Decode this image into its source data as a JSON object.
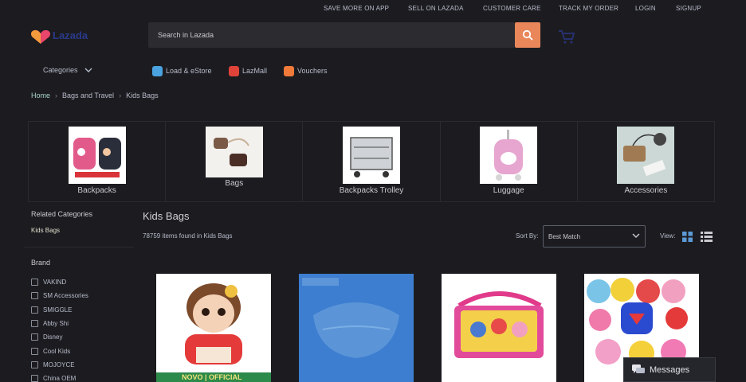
{
  "topbar": {
    "links": [
      "SAVE MORE ON APP",
      "SELL ON LAZADA",
      "CUSTOMER CARE",
      "TRACK MY ORDER",
      "LOGIN",
      "SIGNUP"
    ]
  },
  "header": {
    "logo_text": "Lazada",
    "search_placeholder": "Search in Lazada"
  },
  "nav": {
    "categories_label": "Categories",
    "quick_links": [
      {
        "label": "Load & eStore",
        "color": "#4aa3e0"
      },
      {
        "label": "LazMall",
        "color": "#e0433a"
      },
      {
        "label": "Vouchers",
        "color": "#f07a3a"
      }
    ]
  },
  "breadcrumb": [
    "Home",
    "Bags and Travel",
    "Kids Bags"
  ],
  "category_tiles": [
    {
      "label": "Backpacks",
      "image": "backpacks"
    },
    {
      "label": "Bags",
      "image": "bags"
    },
    {
      "label": "Backpacks Trolley",
      "image": "trolley"
    },
    {
      "label": "Luggage",
      "image": "luggage"
    },
    {
      "label": "Accessories",
      "image": "accessories"
    }
  ],
  "sidebar": {
    "related_title": "Related Categories",
    "related_items": [
      "Kids Bags"
    ],
    "brand_title": "Brand",
    "brands": [
      "VAKIND",
      "SM Accessories",
      "SMIGGLE",
      "Abby Shi",
      "Disney",
      "Cool Kids",
      "MOJOYCE",
      "China OEM"
    ]
  },
  "listing": {
    "title": "Kids Bags",
    "count_text": "78759 items found in Kids Bags",
    "sort_label": "Sort By:",
    "sort_value": "Best Match",
    "view_label": "View:"
  },
  "products": [
    {
      "name": "doll-backpack",
      "badge": "NOVO | OFFICIAL"
    },
    {
      "name": "blue-belt-bag",
      "badge": ""
    },
    {
      "name": "princess-messenger-bag",
      "badge": ""
    },
    {
      "name": "character-backpacks",
      "badge": ""
    }
  ],
  "chat": {
    "label": "Messages"
  },
  "colors": {
    "accent": "#e9875a",
    "background": "#1c1c20",
    "logo": "#e8466a"
  }
}
